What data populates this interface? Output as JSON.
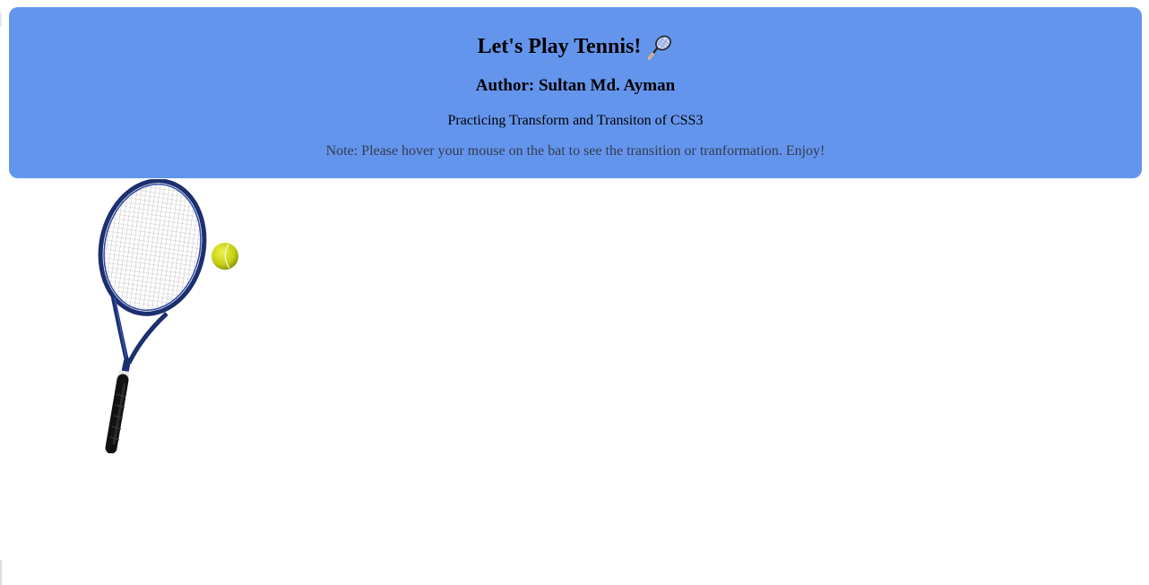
{
  "header": {
    "title": "Let's Play Tennis!",
    "title_icon": "tennis-racket-icon",
    "author": "Author: Sultan Md. Ayman",
    "subtitle": "Practicing Transform and Transiton of CSS3",
    "note": "Note: Please hover your mouse on the bat to see the transition or tranformation. Enjoy!"
  },
  "scene": {
    "racket_icon": "tennis-racket-image",
    "ball_icon": "tennis-ball-image"
  },
  "colors": {
    "header_bg": "#6495ed",
    "racket_frame": "#1e3a8a",
    "ball": "#d8e021"
  }
}
